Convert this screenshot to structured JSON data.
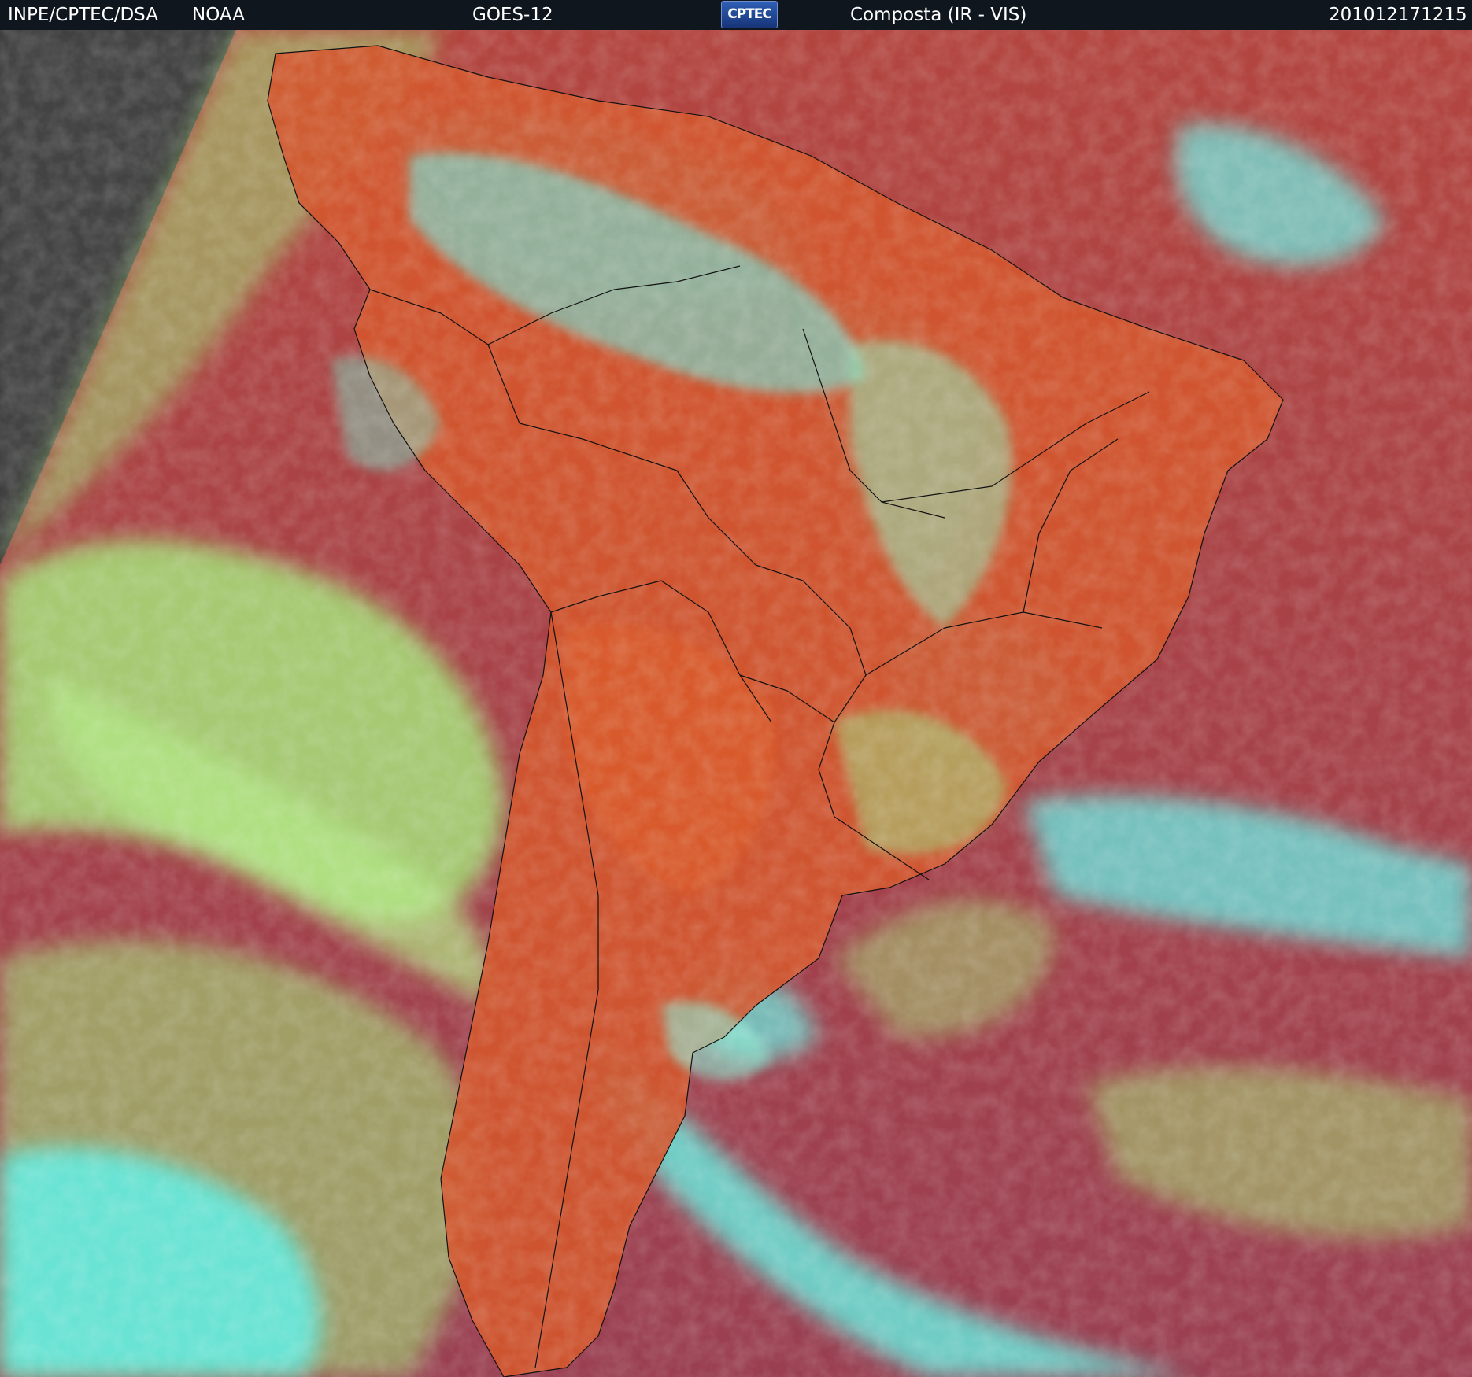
{
  "header": {
    "agency": "INPE/CPTEC/DSA",
    "source": "NOAA",
    "satellite": "GOES-12",
    "logo_text": "CPTEC",
    "product": "Composta (IR - VIS)",
    "timestamp": "201012171215"
  },
  "colors": {
    "header_bg": "#10161e",
    "header_text": "#ffffff",
    "land_clear": "#d2562e",
    "ocean_clear": "#a8404a",
    "low_cloud": "#a6e07a",
    "high_cloud": "#5ff0e8",
    "no_data_space": "#3a3a3a",
    "borders": "#111111"
  }
}
